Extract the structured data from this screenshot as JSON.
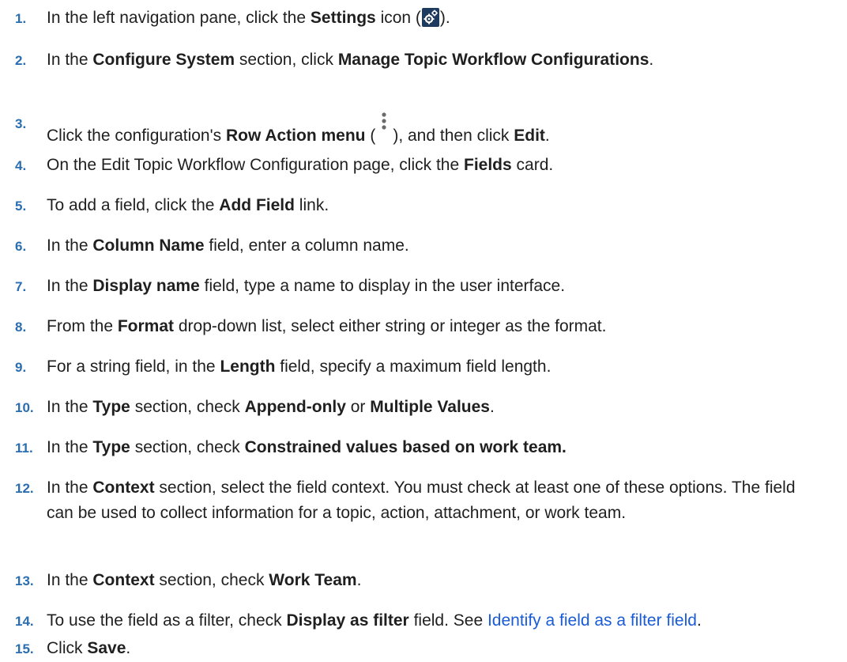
{
  "steps": [
    {
      "number": "1.",
      "parts": [
        "In the left navigation pane, click the ",
        "Settings",
        " icon (",
        ")."
      ]
    },
    {
      "number": "2.",
      "parts": [
        "In the ",
        "Configure System",
        " section, click ",
        "Manage Topic Workflow Configurations",
        "."
      ]
    },
    {
      "number": "3.",
      "parts": [
        "Click the configuration's ",
        "Row Action menu",
        " (",
        "), and then click ",
        "Edit",
        "."
      ]
    },
    {
      "number": "4.",
      "parts": [
        "On the Edit Topic Workflow Configuration page, click the ",
        "Fields",
        " card."
      ]
    },
    {
      "number": "5.",
      "parts": [
        "To add a field, click the ",
        "Add Field",
        " link."
      ]
    },
    {
      "number": "6.",
      "parts": [
        "In the ",
        "Column Name",
        " field, enter a column name."
      ]
    },
    {
      "number": "7.",
      "parts": [
        "In the ",
        "Display name",
        " field, type a name to display in the user interface."
      ]
    },
    {
      "number": "8.",
      "parts": [
        "From the ",
        "Format",
        " drop-down list, select either string or integer as the format."
      ]
    },
    {
      "number": "9.",
      "parts": [
        "For a string field, in the ",
        "Length",
        " field, specify a maximum field length."
      ]
    },
    {
      "number": "10.",
      "parts": [
        "In the ",
        "Type",
        " section, check ",
        "Append-only",
        " or ",
        "Multiple Values",
        "."
      ]
    },
    {
      "number": "11.",
      "parts": [
        "In the ",
        "Type",
        " section, check ",
        "Constrained values based on work team."
      ]
    },
    {
      "number": "12.",
      "parts": [
        "In the ",
        "Context",
        " section, select the field context. You must check at least one of these options. The field can be used to collect information for a topic, action, attachment, or work team."
      ]
    },
    {
      "number": "13.",
      "parts": [
        "In the ",
        "Context",
        " section, check ",
        "Work Team",
        "."
      ]
    },
    {
      "number": "14.",
      "parts": [
        "To use the field as a filter, check ",
        "Display as filter",
        " field. See ",
        "Identify a field as a filter field",
        "."
      ]
    },
    {
      "number": "15.",
      "parts": [
        "Click ",
        "Save",
        "."
      ]
    }
  ],
  "icons": {
    "settings": "settings-gear-icon",
    "row_action": "kebab-menu-icon"
  },
  "colors": {
    "step_number": "#2a6db0",
    "link": "#1a5bd6",
    "icon_bg": "#1e3a5f"
  }
}
